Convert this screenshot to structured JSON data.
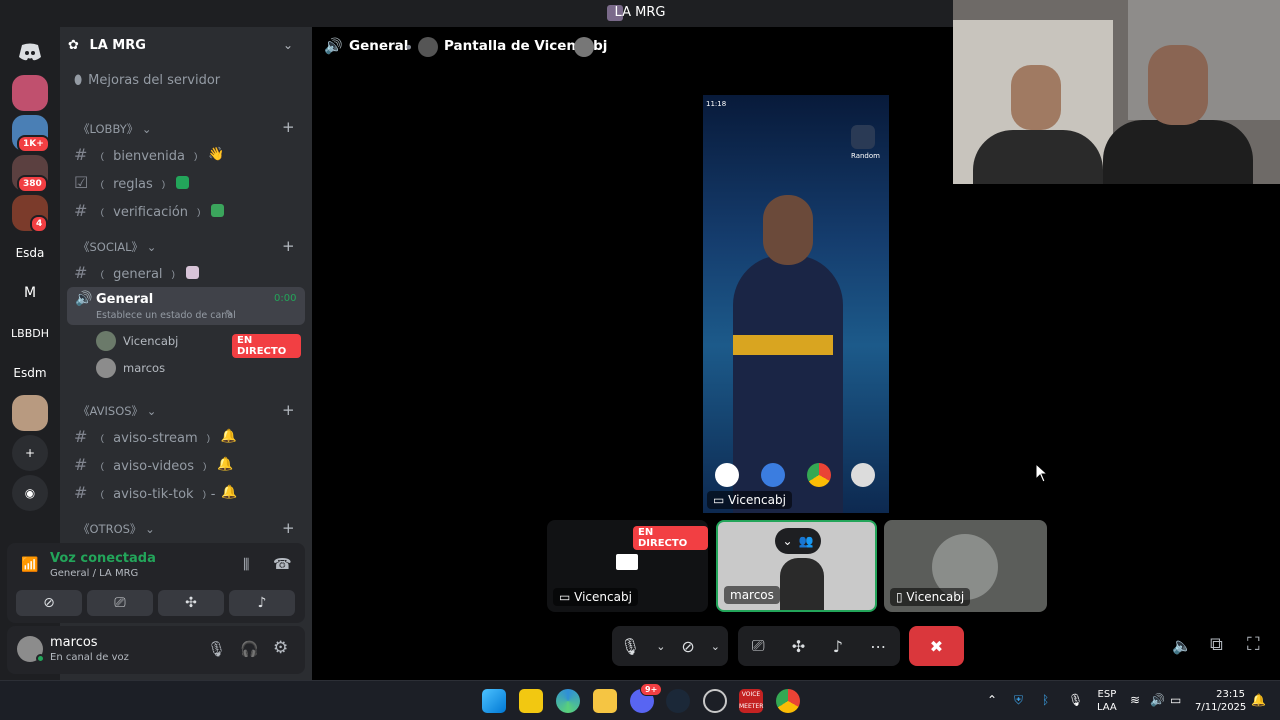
{
  "window": {
    "title": "LA MRG"
  },
  "rail": {
    "servers": [
      {
        "label": "",
        "badge": ""
      },
      {
        "label": "",
        "badge": "1K+"
      },
      {
        "label": "",
        "badge": "380"
      },
      {
        "label": "",
        "badge": "4"
      },
      {
        "label": "Esda",
        "badge": ""
      },
      {
        "label": "M",
        "badge": ""
      },
      {
        "label": "LBBDH",
        "badge": ""
      },
      {
        "label": "Esdm",
        "badge": ""
      }
    ]
  },
  "sidebar": {
    "server_name": "LA MRG",
    "boost": "Mejoras del servidor",
    "categories": {
      "lobby": "《LOBBY》",
      "social": "《SOCIAL》",
      "avisos": "《AVISOS》",
      "otros": "《OTROS》"
    },
    "channels": {
      "bienvenida": "﹙ bienvenida ﹚",
      "reglas": "﹙ reglas ﹚",
      "verificacion": "﹙ verificación ﹚",
      "general_text": "﹙ general ﹚",
      "aviso_stream": "﹙ aviso-stream ﹚",
      "aviso_videos": "﹙ aviso-videos ﹚",
      "aviso_tiktok": "﹙ aviso-tik-tok ﹚-"
    },
    "voice_channel": {
      "name": "General",
      "timer": "0:00",
      "status": "Establece un estado de canal",
      "members": [
        {
          "name": "Vicencabj",
          "live": "EN DIRECTO"
        },
        {
          "name": "marcos",
          "live": ""
        }
      ]
    }
  },
  "voice_panel": {
    "title": "Voz conectada",
    "subtitle": "General / LA MRG"
  },
  "user_panel": {
    "name": "marcos",
    "status": "En canal de voz"
  },
  "header": {
    "channel": "General",
    "stream": "Pantalla de Vicencabj"
  },
  "stream": {
    "phone_time": "11:18",
    "app_label": "Random",
    "overlay_name": "Vicencabj"
  },
  "tiles": [
    {
      "name": "Vicencabj",
      "live": "EN DIRECTO"
    },
    {
      "name": "marcos",
      "live": ""
    },
    {
      "name": "Vicencabj",
      "live": ""
    }
  ],
  "taskbar": {
    "lang": "ESP",
    "lang2": "LAA",
    "time": "23:15",
    "date": "7/11/2025",
    "discord_badge": "9+",
    "voicemeeter": "VOICE MEETER"
  },
  "colors": {
    "accent": "#23a55a",
    "live": "#f23f43",
    "leave": "#da373c"
  }
}
